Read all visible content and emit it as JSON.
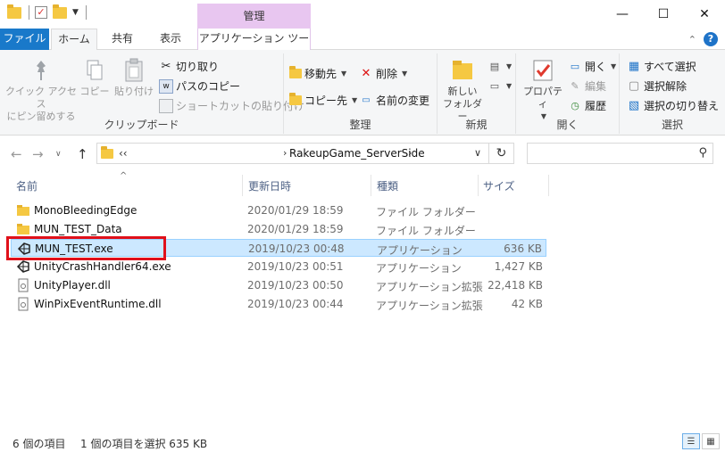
{
  "titlebar": {
    "manage_tab": "管理",
    "minimize": "—",
    "maximize": "☐",
    "close": "✕"
  },
  "tabs": {
    "file": "ファイル",
    "home": "ホーム",
    "share": "共有",
    "view": "表示",
    "app_tools": "アプリケーション ツール"
  },
  "ribbon": {
    "clipboard": {
      "label": "クリップボード",
      "pin_quick_access": "クイック アクセス\nにピン留めする",
      "pin_line1": "クイック アクセス",
      "pin_line2": "にピン留めする",
      "copy": "コピー",
      "paste": "貼り付け",
      "cut": "切り取り",
      "copy_path": "パスのコピー",
      "paste_shortcut": "ショートカットの貼り付け"
    },
    "organize": {
      "label": "整理",
      "move_to": "移動先",
      "copy_to": "コピー先",
      "delete": "削除",
      "rename": "名前の変更"
    },
    "new": {
      "label": "新規",
      "new_folder_line1": "新しい",
      "new_folder_line2": "フォルダー"
    },
    "open": {
      "label": "開く",
      "properties": "プロパティ",
      "open": "開く",
      "edit": "編集",
      "history": "履歴"
    },
    "select": {
      "label": "選択",
      "select_all": "すべて選択",
      "select_none": "選択解除",
      "invert": "選択の切り替え"
    }
  },
  "address": {
    "overflow": "‹‹",
    "current": "RakeupGame_ServerSide",
    "search_placeholder": ""
  },
  "columns": {
    "name": "名前",
    "date": "更新日時",
    "type": "種類",
    "size": "サイズ"
  },
  "files": [
    {
      "name": "MonoBleedingEdge",
      "date": "2020/01/29 18:59",
      "type": "ファイル フォルダー",
      "size": "",
      "icon": "folder-icon"
    },
    {
      "name": "MUN_TEST_Data",
      "date": "2020/01/29 18:59",
      "type": "ファイル フォルダー",
      "size": "",
      "icon": "folder-icon"
    },
    {
      "name": "MUN_TEST.exe",
      "date": "2019/10/23 00:48",
      "type": "アプリケーション",
      "size": "636 KB",
      "icon": "unity-icon"
    },
    {
      "name": "UnityCrashHandler64.exe",
      "date": "2019/10/23 00:51",
      "type": "アプリケーション",
      "size": "1,427 KB",
      "icon": "unity-icon"
    },
    {
      "name": "UnityPlayer.dll",
      "date": "2019/10/23 00:50",
      "type": "アプリケーション拡張",
      "size": "22,418 KB",
      "icon": "dll-icon"
    },
    {
      "name": "WinPixEventRuntime.dll",
      "date": "2019/10/23 00:44",
      "type": "アプリケーション拡張",
      "size": "42 KB",
      "icon": "dll-icon"
    }
  ],
  "status": {
    "item_count": "6 個の項目",
    "selection": "1 個の項目を選択  635 KB"
  }
}
